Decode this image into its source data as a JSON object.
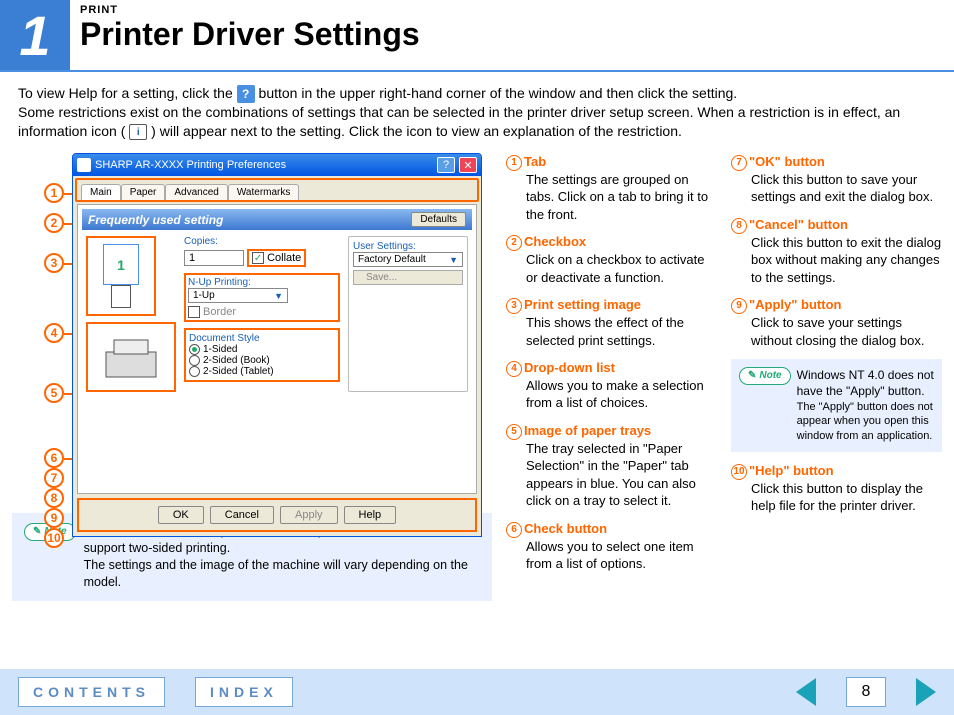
{
  "header": {
    "chapter_number": "1",
    "eyebrow": "PRINT",
    "title": "Printer Driver Settings"
  },
  "intro": {
    "part1": "To view Help for a setting, click the ",
    "help_icon": "?",
    "part2": " button in the upper right-hand corner of the window and then click the setting.",
    "part3": "Some restrictions exist on the combinations of settings that can be selected in the printer driver setup screen. When a restriction is in effect, an information icon ( ",
    "info_icon": "i",
    "part4": " ) will appear next to the setting. Click the icon to view an explanation of the restriction."
  },
  "dialog": {
    "title": "SHARP AR-XXXX Printing Preferences",
    "help_btn": "?",
    "close_btn": "✕",
    "tabs": [
      "Main",
      "Paper",
      "Advanced",
      "Watermarks"
    ],
    "freq_label": "Frequently used setting",
    "defaults_btn": "Defaults",
    "copies_label": "Copies:",
    "copies_value": "1",
    "collate_label": "Collate",
    "nup_label": "N-Up Printing:",
    "nup_value": "1-Up",
    "border_label": "Border",
    "user_settings_label": "User Settings:",
    "user_settings_value": "Factory Default",
    "save_btn": "Save...",
    "doc_style_label": "Document Style",
    "radios": [
      "1-Sided",
      "2-Sided (Book)",
      "2-Sided (Tablet)"
    ],
    "preview_page": "1",
    "buttons": {
      "ok": "OK",
      "cancel": "Cancel",
      "apply": "Apply",
      "help": "Help"
    }
  },
  "callouts": [
    "1",
    "2",
    "3",
    "4",
    "5",
    "6",
    "7",
    "8",
    "9",
    "10"
  ],
  "note1": {
    "badge": "Note",
    "text": "The above screen is the printer driver setup screen for models that support two-sided printing.\nThe settings and the image of the machine will vary depending on the model."
  },
  "defs": [
    {
      "n": "1",
      "title": "Tab",
      "body": "The settings are grouped on tabs. Click on a tab to bring it to the front."
    },
    {
      "n": "2",
      "title": "Checkbox",
      "body": "Click on a checkbox to activate or deactivate a function."
    },
    {
      "n": "3",
      "title": "Print setting image",
      "body": "This shows the effect of the selected print settings."
    },
    {
      "n": "4",
      "title": "Drop-down list",
      "body": "Allows you to make a selection from a list of choices."
    },
    {
      "n": "5",
      "title": "Image of paper trays",
      "body": "The tray selected in \"Paper Selection\" in the \"Paper\" tab appears in blue. You can also click on a tray to select it."
    },
    {
      "n": "6",
      "title": "Check button",
      "body": "Allows you to select one item from a list of options."
    },
    {
      "n": "7",
      "title": "\"OK\" button",
      "body": "Click this button to save your settings and exit the dialog box."
    },
    {
      "n": "8",
      "title": "\"Cancel\" button",
      "body": "Click this button to exit the dialog box without making any changes to the settings."
    },
    {
      "n": "9",
      "title": "\"Apply\" button",
      "body": "Click to save your settings without closing the dialog box."
    },
    {
      "n": "10",
      "title": "\"Help\" button",
      "body": "Click this button to display the help file for the printer driver."
    }
  ],
  "note2": {
    "badge": "Note",
    "line1": "Windows NT 4.0 does not have the \"Apply\" button.",
    "line2": "The \"Apply\" button does not appear when you open this window from an application."
  },
  "footer": {
    "contents": "CONTENTS",
    "index": "INDEX",
    "page": "8"
  }
}
